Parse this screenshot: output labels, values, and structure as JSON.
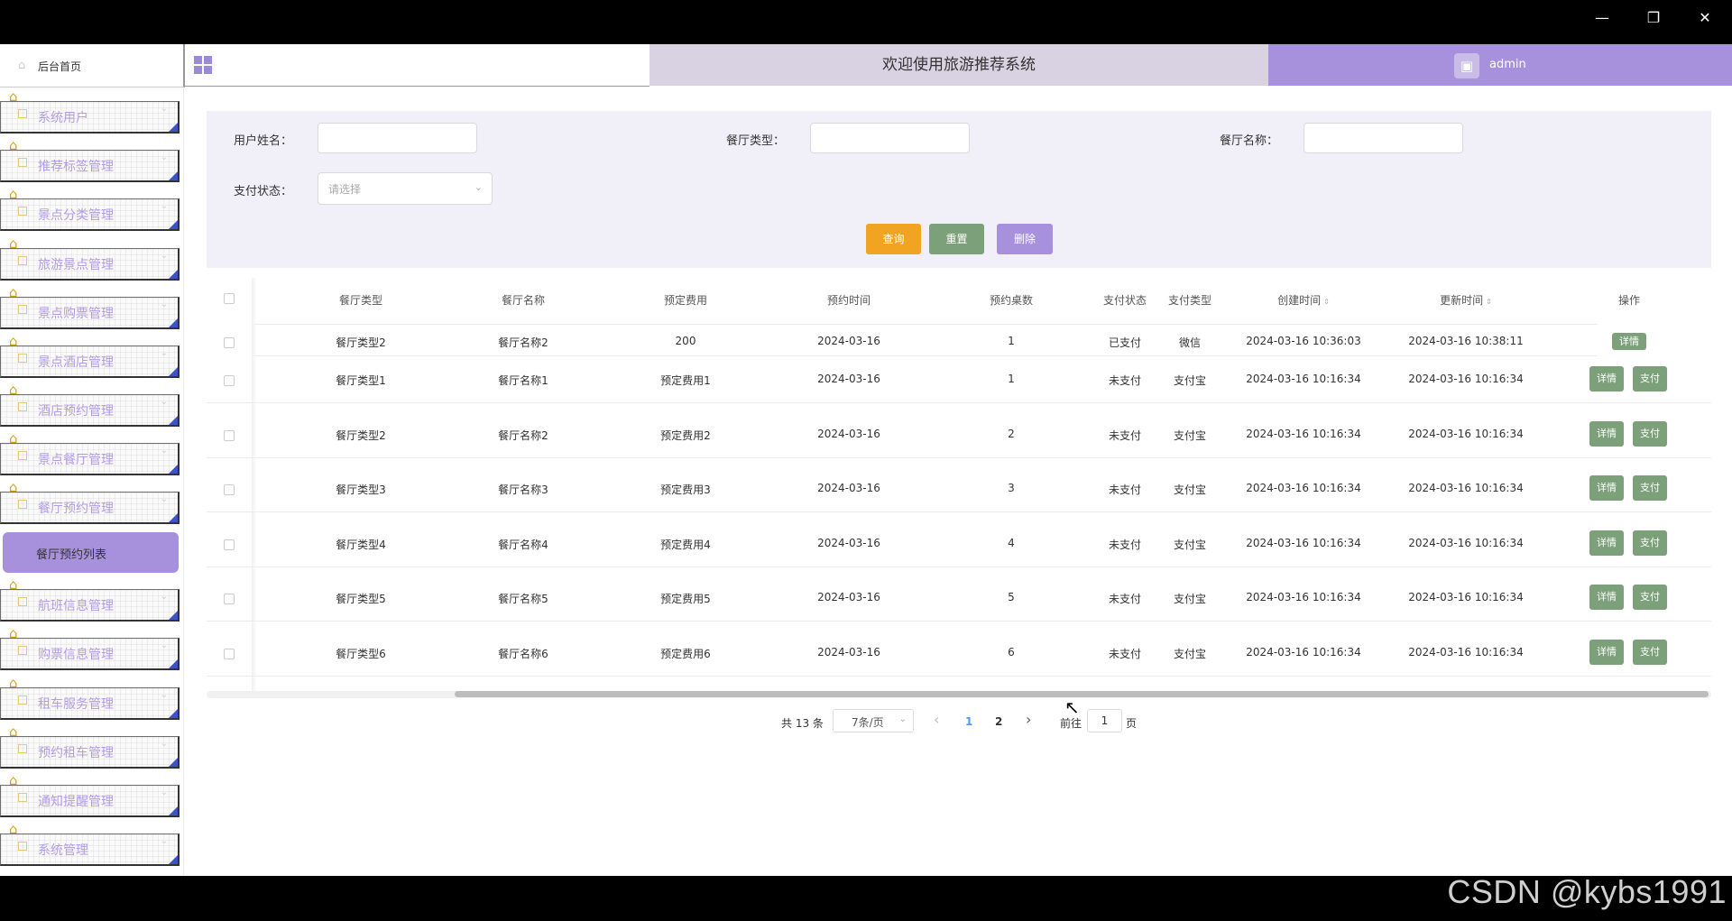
{
  "window": {
    "minimize": "—",
    "maximize": "❐",
    "close": "✕"
  },
  "header": {
    "home_tab": "后台首页",
    "title": "欢迎使用旅游推荐系统",
    "username": "admin"
  },
  "sidebar": {
    "items": [
      {
        "label": "系统用户"
      },
      {
        "label": "推荐标签管理"
      },
      {
        "label": "景点分类管理"
      },
      {
        "label": "旅游景点管理"
      },
      {
        "label": "景点购票管理"
      },
      {
        "label": "景点酒店管理"
      },
      {
        "label": "酒店预约管理"
      },
      {
        "label": "景点餐厅管理"
      },
      {
        "label": "餐厅预约管理"
      },
      {
        "label": "航班信息管理"
      },
      {
        "label": "购票信息管理"
      },
      {
        "label": "租车服务管理"
      },
      {
        "label": "预约租车管理"
      },
      {
        "label": "通知提醒管理"
      },
      {
        "label": "系统管理"
      }
    ],
    "active_sub": "餐厅预约列表"
  },
  "search": {
    "user_name_label": "用户姓名：",
    "user_name_value": "",
    "type_label": "餐厅类型：",
    "type_value": "",
    "name_label": "餐厅名称：",
    "name_value": "",
    "pay_status_label": "支付状态：",
    "pay_status_placeholder": "请选择",
    "query_btn": "查询",
    "reset_btn": "重置",
    "delete_btn": "删除"
  },
  "colors": {
    "accent": "#a891dc",
    "query": "#f0a422",
    "reset": "#7ca17a",
    "delete": "#a891dc",
    "action": "#7ca17a"
  },
  "table": {
    "headers": [
      "餐厅类型",
      "餐厅名称",
      "预定费用",
      "预约时间",
      "预约桌数",
      "支付状态",
      "支付类型",
      "创建时间",
      "更新时间",
      "操作"
    ],
    "detail_btn": "详情",
    "pay_btn": "支付",
    "rows": [
      {
        "type": "餐厅类型2",
        "name": "餐厅名称2",
        "fee": "200",
        "time": "2024-03-16",
        "tables": "1",
        "status": "已支付",
        "pay_type": "微信",
        "created": "2024-03-16 10:36:03",
        "updated": "2024-03-16 10:38:11",
        "pay_action": false
      },
      {
        "type": "餐厅类型1",
        "name": "餐厅名称1",
        "fee": "预定费用1",
        "time": "2024-03-16",
        "tables": "1",
        "status": "未支付",
        "pay_type": "支付宝",
        "created": "2024-03-16 10:16:34",
        "updated": "2024-03-16 10:16:34",
        "pay_action": true
      },
      {
        "type": "餐厅类型2",
        "name": "餐厅名称2",
        "fee": "预定费用2",
        "time": "2024-03-16",
        "tables": "2",
        "status": "未支付",
        "pay_type": "支付宝",
        "created": "2024-03-16 10:16:34",
        "updated": "2024-03-16 10:16:34",
        "pay_action": true
      },
      {
        "type": "餐厅类型3",
        "name": "餐厅名称3",
        "fee": "预定费用3",
        "time": "2024-03-16",
        "tables": "3",
        "status": "未支付",
        "pay_type": "支付宝",
        "created": "2024-03-16 10:16:34",
        "updated": "2024-03-16 10:16:34",
        "pay_action": true
      },
      {
        "type": "餐厅类型4",
        "name": "餐厅名称4",
        "fee": "预定费用4",
        "time": "2024-03-16",
        "tables": "4",
        "status": "未支付",
        "pay_type": "支付宝",
        "created": "2024-03-16 10:16:34",
        "updated": "2024-03-16 10:16:34",
        "pay_action": true
      },
      {
        "type": "餐厅类型5",
        "name": "餐厅名称5",
        "fee": "预定费用5",
        "time": "2024-03-16",
        "tables": "5",
        "status": "未支付",
        "pay_type": "支付宝",
        "created": "2024-03-16 10:16:34",
        "updated": "2024-03-16 10:16:34",
        "pay_action": true
      },
      {
        "type": "餐厅类型6",
        "name": "餐厅名称6",
        "fee": "预定费用6",
        "time": "2024-03-16",
        "tables": "6",
        "status": "未支付",
        "pay_type": "支付宝",
        "created": "2024-03-16 10:16:34",
        "updated": "2024-03-16 10:16:34",
        "pay_action": true
      }
    ]
  },
  "pagination": {
    "total": "共 13 条",
    "page_size": "7条/页",
    "prev": "‹",
    "pages": [
      "1",
      "2"
    ],
    "current": "1",
    "next": "›",
    "goto_label": "前往",
    "goto_value": "1",
    "page_suffix": "页"
  },
  "watermark": "CSDN @kybs1991"
}
